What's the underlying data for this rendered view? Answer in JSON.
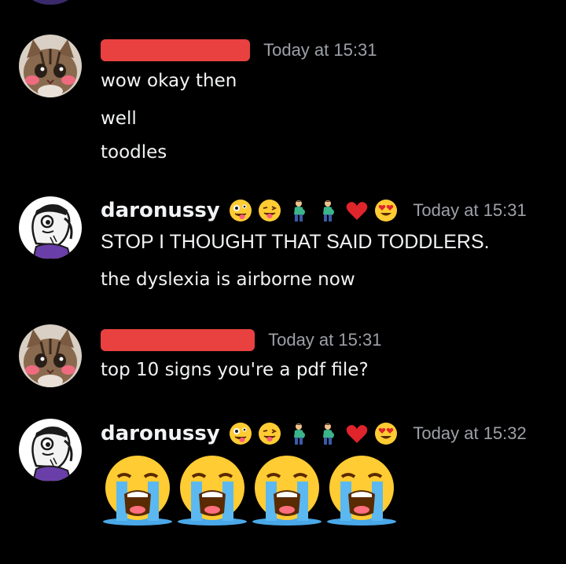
{
  "messages": [
    {
      "author": "",
      "author_redacted": true,
      "timestamp": "Today at 15:31",
      "lines": [
        "wow okay then",
        "well",
        "toodles"
      ]
    },
    {
      "author": "daronussy",
      "author_redacted": false,
      "timestamp": "Today at 15:31",
      "badges": [
        "zany-face",
        "winking-tongue-face",
        "pregnant-man",
        "pregnant-man",
        "red-heart",
        "heart-eyes-face"
      ],
      "lines": [
        "STOP I THOUGHT THAT SAID TODDLERS.",
        "the dyslexia is airborne now"
      ]
    },
    {
      "author": "",
      "author_redacted": true,
      "timestamp": "Today at 15:31",
      "lines": [
        "top 10 signs you're a pdf file?"
      ]
    },
    {
      "author": "daronussy",
      "author_redacted": false,
      "timestamp": "Today at 15:32",
      "badges": [
        "zany-face",
        "winking-tongue-face",
        "pregnant-man",
        "pregnant-man",
        "red-heart",
        "heart-eyes-face"
      ],
      "emoji_message": [
        "loudly-crying-face",
        "loudly-crying-face",
        "loudly-crying-face",
        "loudly-crying-face"
      ]
    }
  ],
  "colors": {
    "background": "#000000",
    "text": "#f2f3f5",
    "timestamp": "#9da0a6",
    "redaction": "#e8413f"
  }
}
